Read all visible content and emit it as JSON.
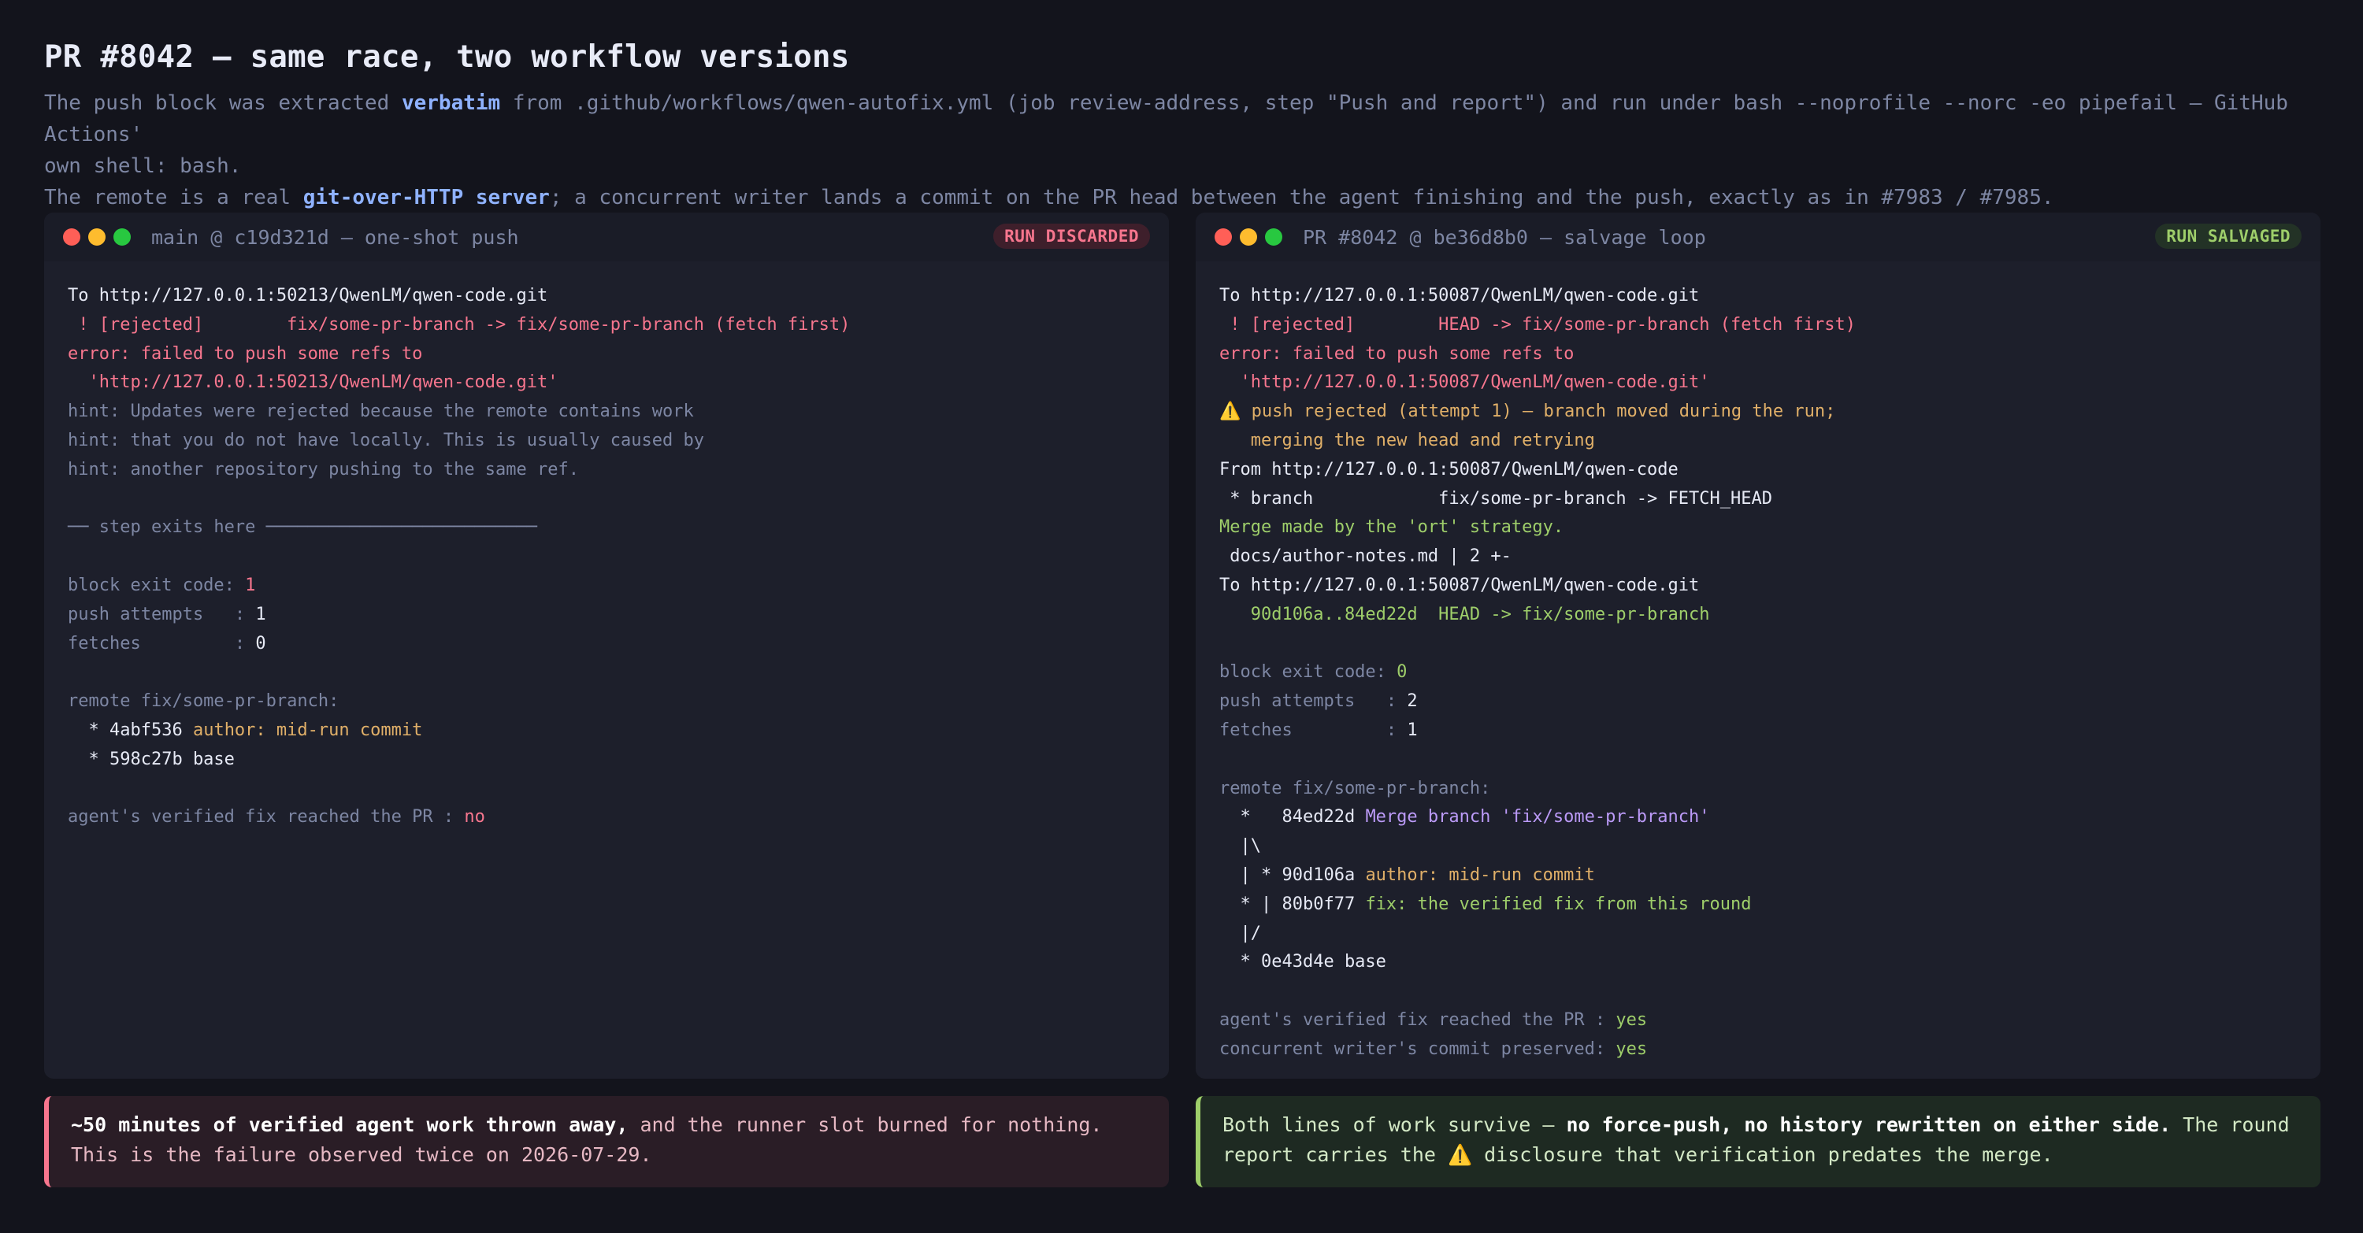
{
  "header": {
    "title": "PR #8042 — same race, two workflow versions",
    "line1_a": "The push block was extracted ",
    "line1_b": "verbatim",
    "line1_c": " from .github/workflows/qwen-autofix.yml (job review-address, step \"Push and report\") and run under bash --noprofile --norc -eo pipefail — GitHub Actions'",
    "line1_d": "own shell: bash.",
    "line2_a": "The remote is a real ",
    "line2_b": "git-over-HTTP server",
    "line2_c": "; a concurrent writer lands a commit on the PR head between the agent finishing and the push, exactly as in #7983 / #7985."
  },
  "left": {
    "title": "main @ c19d321d — one-shot push",
    "badge": "RUN DISCARDED",
    "l1": "To http://127.0.0.1:50213/QwenLM/qwen-code.git",
    "l2": " ! [rejected]        fix/some-pr-branch -> fix/some-pr-branch (fetch first)",
    "l3": "error: failed to push some refs to",
    "l4": "  'http://127.0.0.1:50213/QwenLM/qwen-code.git'",
    "l5": "hint: Updates were rejected because the remote contains work",
    "l6": "hint: that you do not have locally. This is usually caused by",
    "l7": "hint: another repository pushing to the same ref.",
    "l8": "── step exits here ──────────────────────────",
    "exit_label": "block exit code: ",
    "exit_val": "1",
    "attempts_label": "push attempts   : ",
    "attempts_val": "1",
    "fetches_label": "fetches         : ",
    "fetches_val": "0",
    "remote_label": "remote fix/some-pr-branch:",
    "c1_hash": "  * 4abf536 ",
    "c1_msg": "author: mid-run commit",
    "c2": "  * 598c27b base",
    "verified_label": "agent's verified fix reached the PR : ",
    "verified_val": "no"
  },
  "right": {
    "title": "PR #8042 @ be36d8b0 — salvage loop",
    "badge": "RUN SALVAGED",
    "l1": "To http://127.0.0.1:50087/QwenLM/qwen-code.git",
    "l2": " ! [rejected]        HEAD -> fix/some-pr-branch (fetch first)",
    "l3": "error: failed to push some refs to",
    "l4": "  'http://127.0.0.1:50087/QwenLM/qwen-code.git'",
    "l5": "⚠️ push rejected (attempt 1) — branch moved during the run;",
    "l6": "   merging the new head and retrying",
    "l7": "From http://127.0.0.1:50087/QwenLM/qwen-code",
    "l8": " * branch            fix/some-pr-branch -> FETCH_HEAD",
    "l9": "Merge made by the 'ort' strategy.",
    "l10": " docs/author-notes.md | 2 +-",
    "l11": "To http://127.0.0.1:50087/QwenLM/qwen-code.git",
    "l12": "   90d106a..84ed22d  HEAD -> fix/some-pr-branch",
    "exit_label": "block exit code: ",
    "exit_val": "0",
    "attempts_label": "push attempts   : ",
    "attempts_val": "2",
    "fetches_label": "fetches         : ",
    "fetches_val": "1",
    "remote_label": "remote fix/some-pr-branch:",
    "g1_hash": "  *   84ed22d ",
    "g1_msg": "Merge branch 'fix/some-pr-branch'",
    "g2": "  |\\",
    "g3_hash": "  | * 90d106a ",
    "g3_msg": "author: mid-run commit",
    "g4_hash": "  * | 80b0f77 ",
    "g4_msg": "fix: the verified fix from this round",
    "g5": "  |/",
    "g6": "  * 0e43d4e base",
    "verified_label": "agent's verified fix reached the PR : ",
    "verified_val": "yes",
    "preserved_label": "concurrent writer's commit preserved: ",
    "preserved_val": "yes"
  },
  "notes": {
    "left_bold": "~50 minutes of verified agent work thrown away,",
    "left_rest": " and the runner slot burned for nothing. This is the failure observed twice on 2026-07-29.",
    "right_a": "Both lines of work survive — ",
    "right_bold": "no force-push, no history rewritten on either side.",
    "right_b": " The round report carries the ⚠️ disclosure that verification predates the merge."
  }
}
